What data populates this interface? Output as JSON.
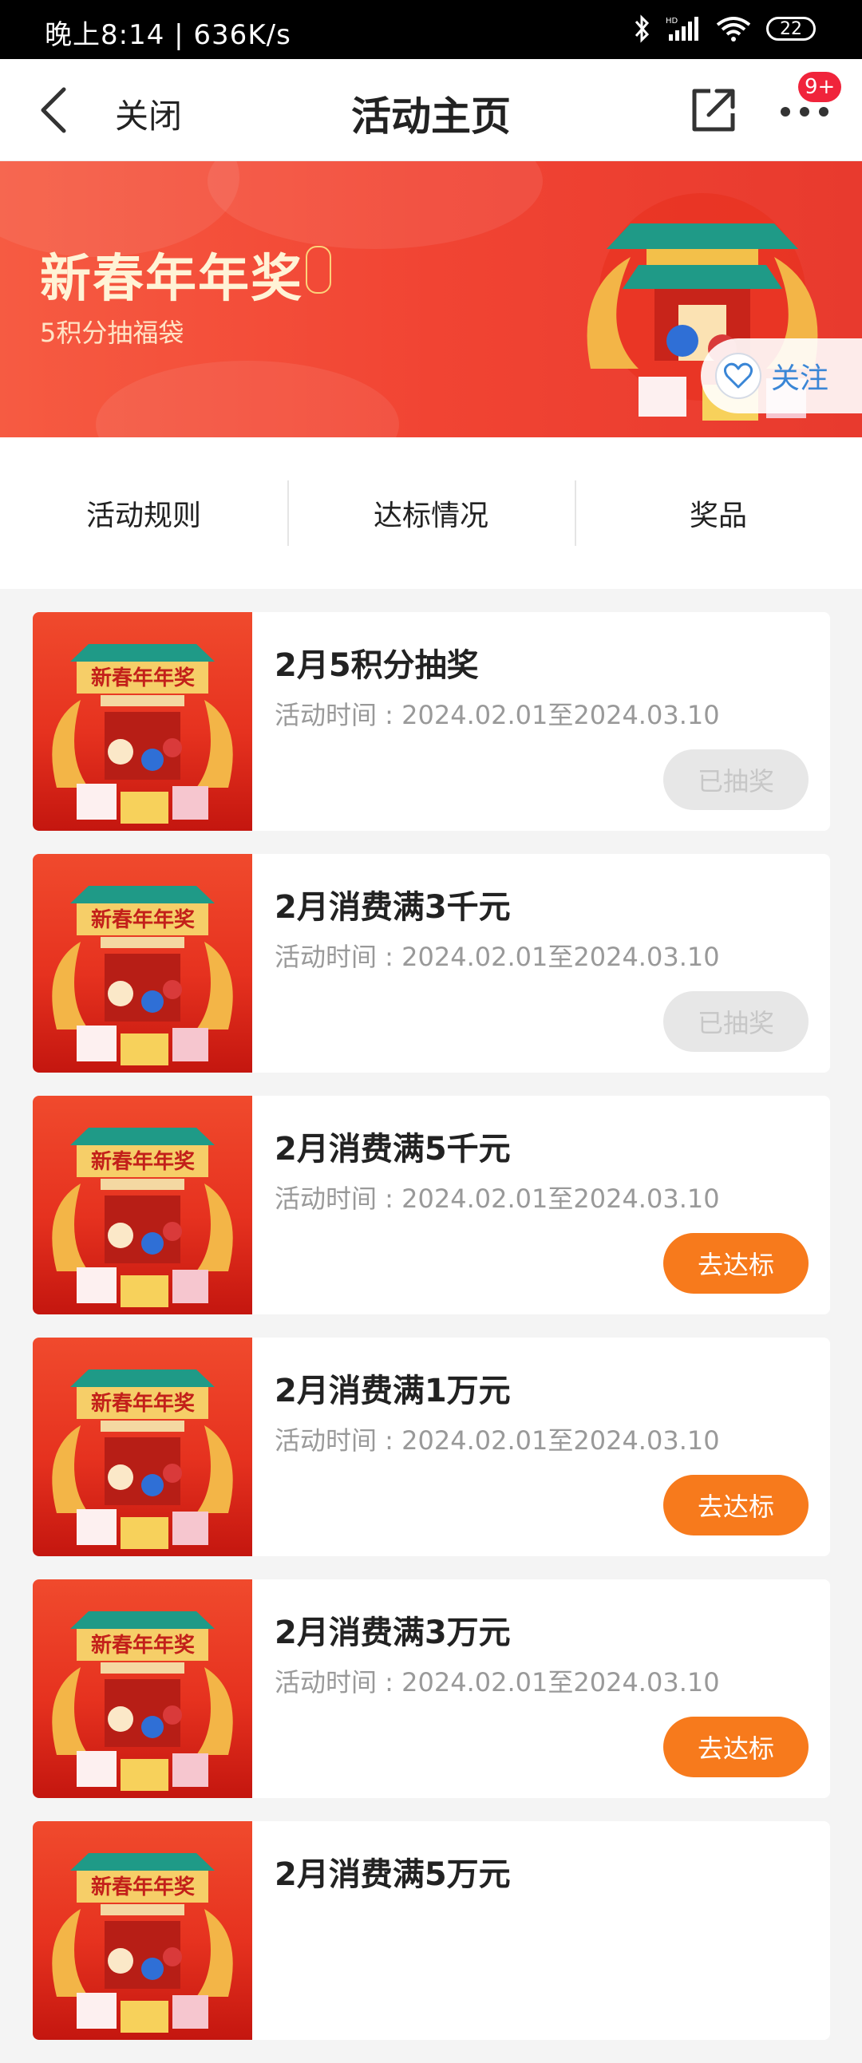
{
  "status": {
    "time": "晚上8:14 | 636K/s",
    "battery": "22"
  },
  "nav": {
    "close_label": "关闭",
    "title": "活动主页",
    "badge": "9+"
  },
  "banner": {
    "title": "新春年年奖",
    "subtitle": "5积分抽福袋",
    "follow_label": "关注"
  },
  "tabs": [
    "活动规则",
    "达标情况",
    "奖品"
  ],
  "activities": [
    {
      "title": "2月5积分抽奖",
      "period_label": "活动时间 : ",
      "period": "2024.02.01至2024.03.10",
      "action": "已抽奖",
      "state": "done"
    },
    {
      "title": "2月消费满3千元",
      "period_label": "活动时间 : ",
      "period": "2024.02.01至2024.03.10",
      "action": "已抽奖",
      "state": "done"
    },
    {
      "title": "2月消费满5千元",
      "period_label": "活动时间 : ",
      "period": "2024.02.01至2024.03.10",
      "action": "去达标",
      "state": "go"
    },
    {
      "title": "2月消费满1万元",
      "period_label": "活动时间 : ",
      "period": "2024.02.01至2024.03.10",
      "action": "去达标",
      "state": "go"
    },
    {
      "title": "2月消费满3万元",
      "period_label": "活动时间 : ",
      "period": "2024.02.01至2024.03.10",
      "action": "去达标",
      "state": "go"
    },
    {
      "title": "2月消费满5万元",
      "period_label": "",
      "period": "",
      "action": "",
      "state": "partial"
    }
  ],
  "thumb_text": "新春年年奖",
  "colors": {
    "accent_orange": "#f77a1c",
    "banner_red": "#f14433",
    "disabled_gray": "#e7e7e7"
  }
}
